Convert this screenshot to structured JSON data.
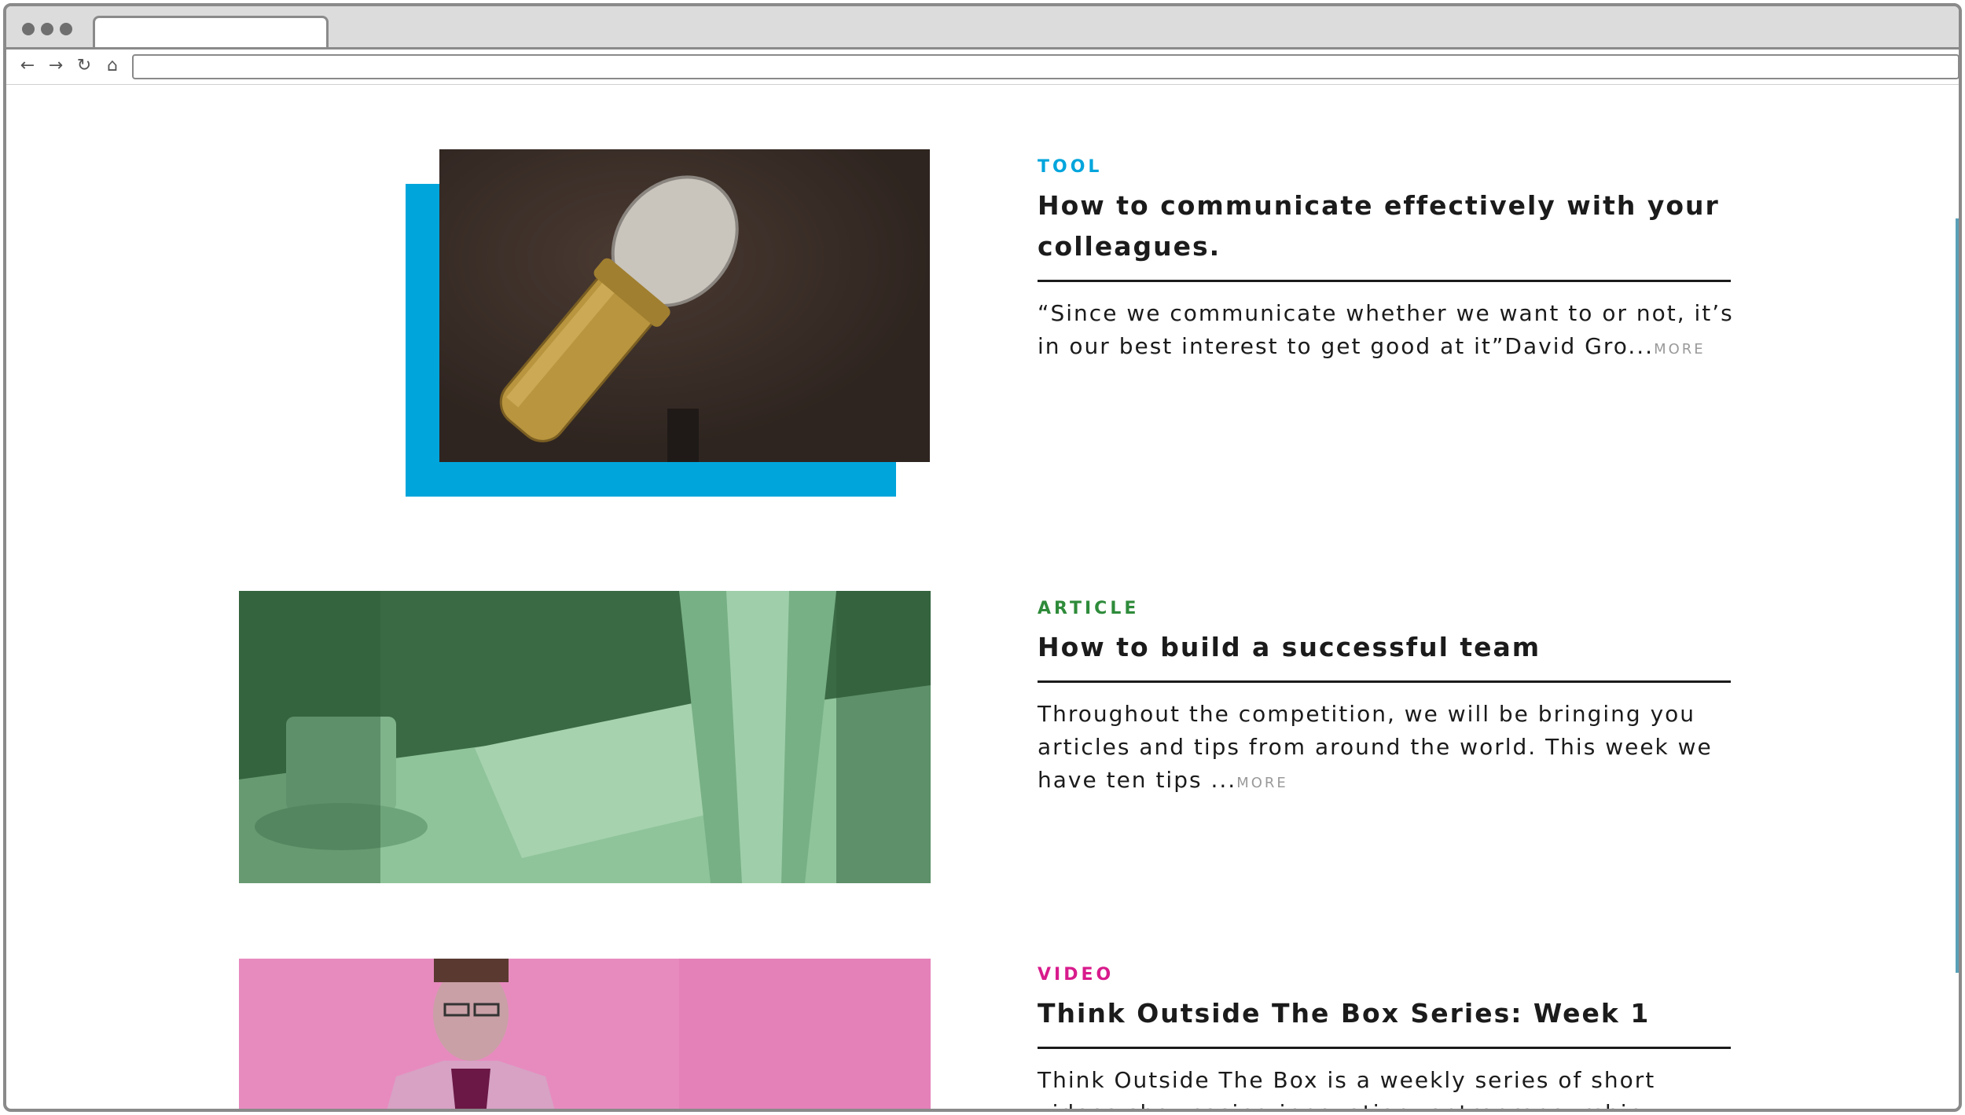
{
  "browser": {
    "url": ""
  },
  "colors": {
    "tool": "#00a5dc",
    "article": "#2e8b3a",
    "video": "#d81b8c"
  },
  "posts": [
    {
      "category": "TOOL",
      "title": "How to communicate effectively with your colleagues.",
      "excerpt": "“Since we communicate whether we want to or not, it’s in our best interest to get good at it”David Gro...",
      "more": "MORE",
      "image": "microphone-photo"
    },
    {
      "category": "ARTICLE",
      "title": "How to build a successful team",
      "excerpt": "Throughout the competition, we will be bringing you articles and tips from around the world. This week we have ten tips ...",
      "more": "MORE",
      "image": "team-meeting-photo"
    },
    {
      "category": "VIDEO",
      "title": "Think Outside The Box Series: Week 1",
      "excerpt": "Think Outside The Box is a weekly series of short videos showcasing innovation, entrepreneurship",
      "more": "",
      "image": "speaker-photo"
    }
  ]
}
